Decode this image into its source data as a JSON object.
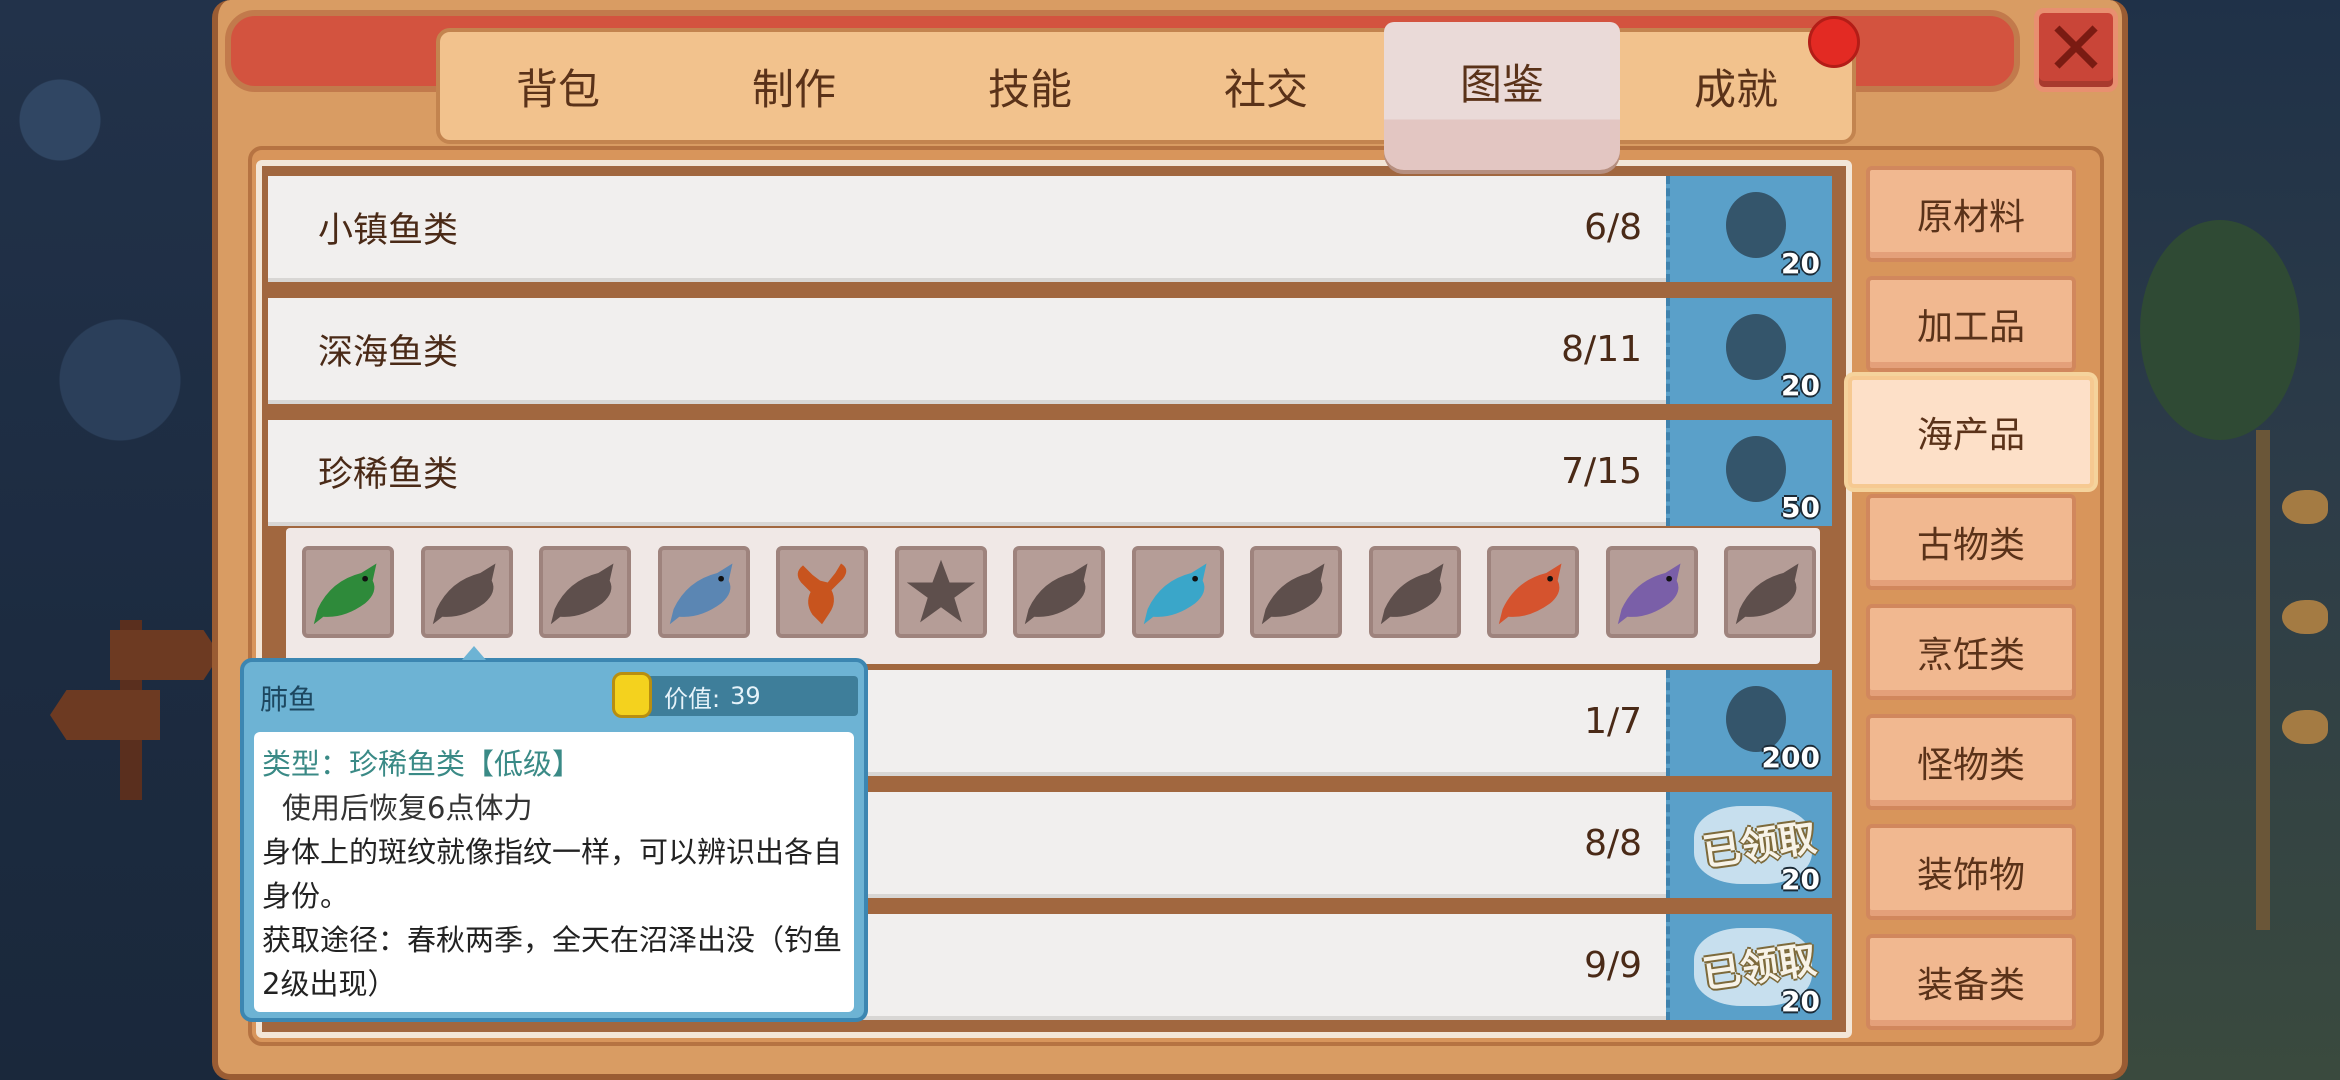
{
  "tabs": [
    {
      "label": "背包",
      "active": false
    },
    {
      "label": "制作",
      "active": false
    },
    {
      "label": "技能",
      "active": false
    },
    {
      "label": "社交",
      "active": false
    },
    {
      "label": "图鉴",
      "active": true
    },
    {
      "label": "成就",
      "active": false
    }
  ],
  "rows": [
    {
      "name": "小镇鱼类",
      "count": "6/8",
      "reward": "20",
      "claimed": false
    },
    {
      "name": "深海鱼类",
      "count": "8/11",
      "reward": "20",
      "claimed": false
    },
    {
      "name": "珍稀鱼类",
      "count": "7/15",
      "reward": "50",
      "claimed": false
    },
    {
      "name": "",
      "count": "1/7",
      "reward": "200",
      "claimed": false
    },
    {
      "name": "",
      "count": "8/8",
      "reward": "20",
      "claimed": true
    },
    {
      "name": "",
      "count": "9/9",
      "reward": "20",
      "claimed": true
    }
  ],
  "claimed_label": "已领取",
  "fish_slots": [
    {
      "icon": "green-fish-icon",
      "discovered": true,
      "color": "#2e8a3a"
    },
    {
      "icon": "unknown-silhouette-icon",
      "discovered": false
    },
    {
      "icon": "unknown-silhouette-icon",
      "discovered": false
    },
    {
      "icon": "blue-fish-icon",
      "discovered": true,
      "color": "#5b86b3"
    },
    {
      "icon": "lobster-icon",
      "discovered": true,
      "color": "#c8541e"
    },
    {
      "icon": "unknown-starfish-icon",
      "discovered": false
    },
    {
      "icon": "unknown-silhouette-icon",
      "discovered": false
    },
    {
      "icon": "teal-fish-icon",
      "discovered": true,
      "color": "#3aa6c9"
    },
    {
      "icon": "unknown-silhouette-icon",
      "discovered": false
    },
    {
      "icon": "unknown-silhouette-icon",
      "discovered": false
    },
    {
      "icon": "red-fish-icon",
      "discovered": true,
      "color": "#d5532e"
    },
    {
      "icon": "purple-fish-icon",
      "discovered": true,
      "color": "#7a5fa8"
    },
    {
      "icon": "unknown-silhouette-icon",
      "discovered": false
    }
  ],
  "categories": [
    {
      "label": "原材料",
      "active": false
    },
    {
      "label": "加工品",
      "active": false
    },
    {
      "label": "海产品",
      "active": true
    },
    {
      "label": "古物类",
      "active": false
    },
    {
      "label": "烹饪类",
      "active": false
    },
    {
      "label": "怪物类",
      "active": false
    },
    {
      "label": "装饰物",
      "active": false
    },
    {
      "label": "装备类",
      "active": false
    }
  ],
  "tooltip": {
    "title": "肺鱼",
    "price_label": "价值:",
    "price_value": "39",
    "type": "类型：珍稀鱼类【低级】",
    "effect": "使用后恢复6点体力",
    "desc": "身体上的斑纹就像指纹一样，可以辨识出各自身份。",
    "source": "获取途径：春秋两季，全天在沼泽出没（钓鱼2级出现）"
  },
  "colors": {
    "frame": "#d99c63",
    "reward_blue": "#5aa0c9",
    "close_red": "#c94538",
    "alert_red": "#e32a23"
  }
}
